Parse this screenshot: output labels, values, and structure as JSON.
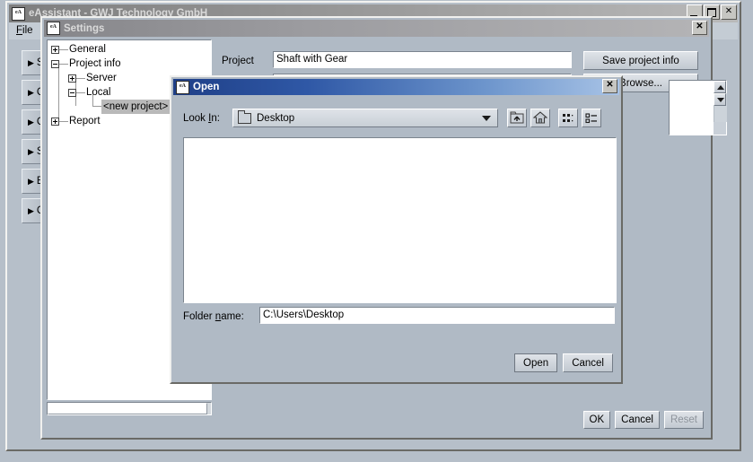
{
  "main_window": {
    "title": "eAssistant - GWJ Technology GmbH",
    "icon": "app-icon",
    "menu": [
      {
        "label": "File",
        "mnemonic": "F"
      }
    ],
    "window_buttons": [
      {
        "name": "minimize",
        "glyph": ""
      },
      {
        "name": "maximize",
        "glyph": ""
      },
      {
        "name": "close",
        "glyph": "✕"
      }
    ],
    "sidebar_items": [
      {
        "arrow": "▶",
        "label": "S"
      },
      {
        "arrow": "▶",
        "label": "C"
      },
      {
        "arrow": "▶",
        "label": "C"
      },
      {
        "arrow": "▶",
        "label": "S"
      },
      {
        "arrow": "▶",
        "label": "E"
      },
      {
        "arrow": "▶",
        "label": "C"
      }
    ]
  },
  "settings_dialog": {
    "title": "Settings",
    "close_label": "✕",
    "tree": [
      {
        "label": "General",
        "state": "collapsed",
        "depth": 0,
        "selected": false
      },
      {
        "label": "Project info",
        "state": "expanded",
        "depth": 0,
        "selected": false
      },
      {
        "label": "Server",
        "state": "collapsed",
        "depth": 1,
        "selected": false
      },
      {
        "label": "Local",
        "state": "expanded",
        "depth": 1,
        "selected": false
      },
      {
        "label": "<new project>",
        "state": "leaf",
        "depth": 2,
        "selected": true
      },
      {
        "label": "Report",
        "state": "collapsed",
        "depth": 0,
        "selected": false
      }
    ],
    "project_label": "Project",
    "project_value": "Shaft with Gear",
    "second_field_value": "",
    "save_project_info_label": "Save project info",
    "browse_label": "Browse...",
    "buttons": [
      {
        "label": "OK",
        "enabled": true
      },
      {
        "label": "Cancel",
        "enabled": true
      },
      {
        "label": "Reset",
        "enabled": false
      }
    ]
  },
  "open_dialog": {
    "title": "Open",
    "close_label": "✕",
    "lookin_label_pre": "Look ",
    "lookin_label_mnemonic": "I",
    "lookin_label_post": "n:",
    "lookin_value": "Desktop",
    "lookin_icon": "folder-icon",
    "toolbar": [
      {
        "name": "up-folder-icon",
        "tooltip": "Up One Level"
      },
      {
        "name": "home-icon",
        "tooltip": "Home"
      },
      {
        "name": "grid-view-icon",
        "tooltip": "Details"
      },
      {
        "name": "list-view-icon",
        "tooltip": "List"
      }
    ],
    "file_list_items": [],
    "foldername_label_pre": "Folder ",
    "foldername_label_mnemonic": "n",
    "foldername_label_post": "ame:",
    "foldername_value": "C:\\Users\\Desktop",
    "buttons": [
      {
        "label": "Open",
        "default": true
      },
      {
        "label": "Cancel",
        "default": false
      }
    ]
  },
  "colors": {
    "dialog_bg": "#b0bac5",
    "window_bg": "#b6bfc9",
    "active_title_start": "#1f3f87",
    "active_title_end": "#a8c3e6",
    "inactive_title": "#9c9ca0",
    "field_bg": "#ffffff",
    "selection_bg": "#b9b9b9"
  }
}
